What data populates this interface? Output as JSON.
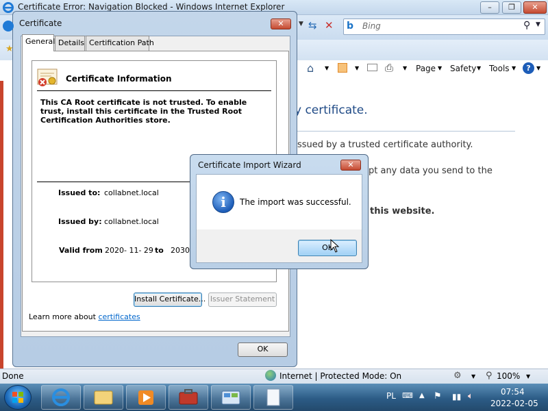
{
  "ie": {
    "title": "Certificate Error: Navigation Blocked - Windows Internet Explorer",
    "search_placeholder": "Bing",
    "commands": {
      "page": "Page",
      "safety": "Safety",
      "tools": "Tools"
    },
    "content": {
      "heading": "y certificate.",
      "line1": "ssued by a trusted certificate authority.",
      "line2": "pt any data you send to the",
      "line3": "this website."
    },
    "status": {
      "left": "Done",
      "zone": "Internet | Protected Mode: On",
      "zoom": "100%"
    }
  },
  "cert_dialog": {
    "title": "Certificate",
    "tabs": [
      {
        "label": "General",
        "active": true
      },
      {
        "label": "Details",
        "active": false
      },
      {
        "label": "Certification Path",
        "active": false
      }
    ],
    "info_heading": "Certificate Information",
    "message": "This CA Root certificate is not trusted. To enable trust, install this certificate in the Trusted Root Certification Authorities store.",
    "issued_to_label": "Issued to:",
    "issued_to_value": "collabnet.local",
    "issued_by_label": "Issued by:",
    "issued_by_value": "collabnet.local",
    "valid_from_label": "Valid from",
    "valid_from_value": "2020- 11- 29",
    "valid_to_label": "to",
    "valid_to_value": "2030-",
    "install_button": "Install Certificate...",
    "issuer_statement_button": "Issuer Statement",
    "learn_more_prefix": "Learn more about",
    "learn_more_link": "certificates",
    "ok_button": "OK"
  },
  "wizard_dialog": {
    "title": "Certificate Import Wizard",
    "message": "The import was successful.",
    "ok_button": "OK"
  },
  "taskbar": {
    "language": "PL",
    "time": "07:54",
    "date": "2022-02-05"
  },
  "colors": {
    "accent_blue": "#1f4a86",
    "error_red": "#c8442c",
    "link": "#0066cc"
  }
}
